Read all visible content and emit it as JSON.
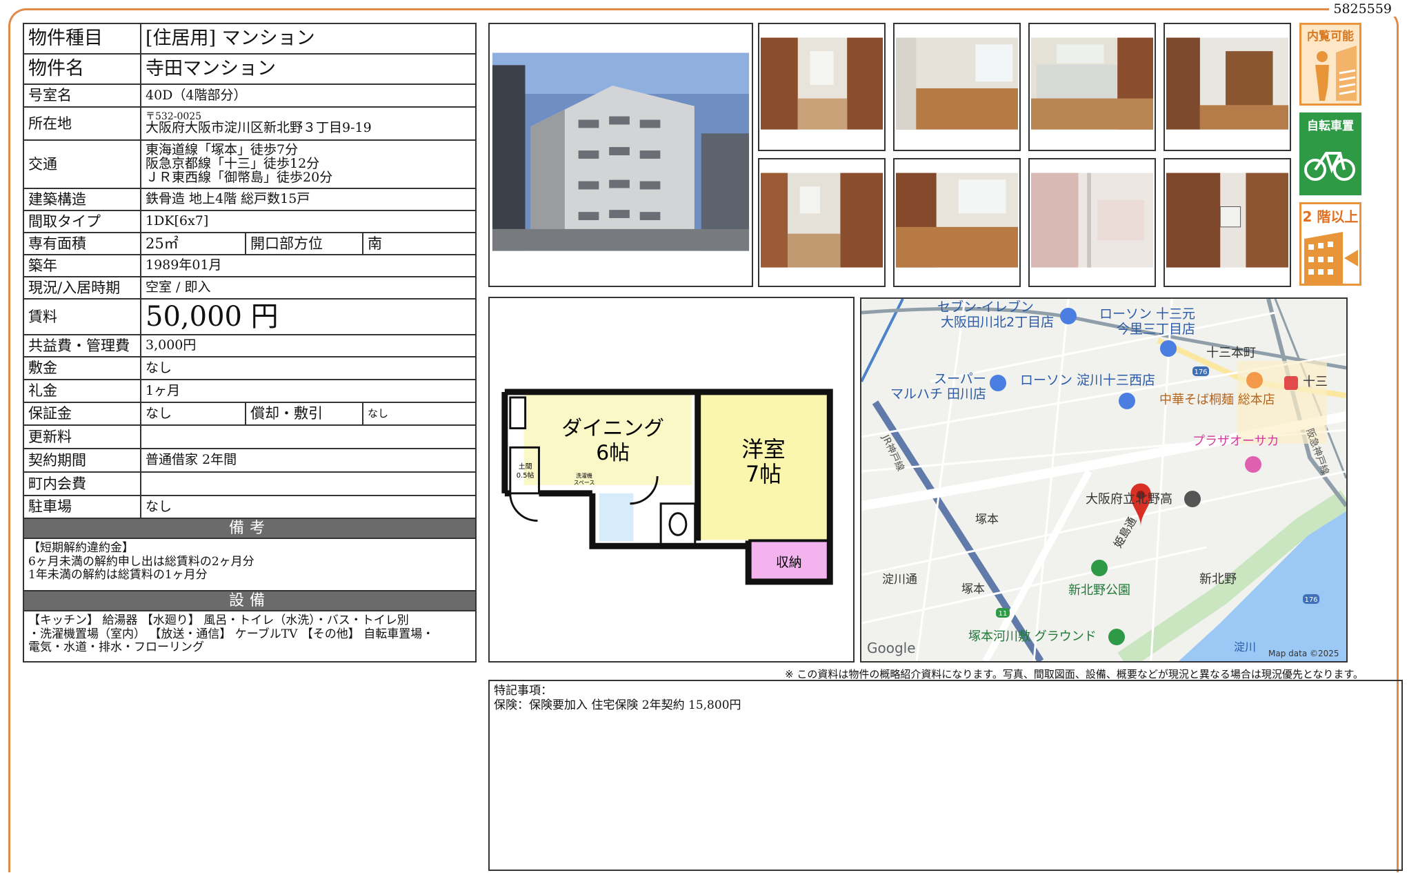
{
  "doc_id": "5825559",
  "rows": {
    "type": {
      "label": "物件種目",
      "value": "[住居用]  マンション"
    },
    "name": {
      "label": "物件名",
      "value": "寺田マンション"
    },
    "room": {
      "label": "号室名",
      "value": "40D（4階部分）"
    },
    "address": {
      "label": "所在地",
      "postal": "〒532-0025",
      "value": "大阪府大阪市淀川区新北野３丁目9-19"
    },
    "access": {
      "label": "交通",
      "lines": [
        "東海道線「塚本」徒歩7分",
        "阪急京都線「十三」徒歩12分",
        "ＪＲ東西線「御幣島」徒歩20分"
      ]
    },
    "structure": {
      "label": "建築構造",
      "value": "鉄骨造 地上4階  総戸数15戸"
    },
    "layout": {
      "label": "間取タイプ",
      "value": "1DK[6x7]"
    },
    "area": {
      "label": "専有面積",
      "value": "25㎡",
      "sub_label": "開口部方位",
      "sub_value": "南"
    },
    "built": {
      "label": "築年",
      "value": "1989年01月"
    },
    "status": {
      "label": "現況/入居時期",
      "value": "空室  /  即入"
    },
    "rent": {
      "label": "賃料",
      "value": "50,000  円"
    },
    "fee": {
      "label": "共益費・管理費",
      "value": "3,000円"
    },
    "deposit": {
      "label": "敷金",
      "value": "なし"
    },
    "key_money": {
      "label": "礼金",
      "value": "1ヶ月"
    },
    "guarantee": {
      "label": "保証金",
      "value": "なし",
      "sub_label": "償却・敷引",
      "sub_value": "なし"
    },
    "renewal": {
      "label": "更新料",
      "value": ""
    },
    "contract": {
      "label": "契約期間",
      "value": "普通借家  2年間"
    },
    "association": {
      "label": "町内会費",
      "value": ""
    },
    "parking": {
      "label": "駐車場",
      "value": "なし"
    }
  },
  "remarks_header": "備考",
  "remarks_lines": [
    "【短期解約違約金】",
    "6ヶ月未満の解約申し出は総賃料の2ヶ月分",
    "1年未満の解約は総賃料の1ヶ月分"
  ],
  "equipment_header": "設備",
  "equipment_lines": [
    "【キッチン】 給湯器  【水廻り】 風呂・トイレ（水洗）・バス・トイレ別",
    "・洗濯機置場（室内） 【放送・通信】 ケーブルTV  【その他】 自転車置場・",
    "電気・水道・排水・フローリング"
  ],
  "badges": [
    {
      "text": "内覧可能",
      "color": "#e8953a"
    },
    {
      "text": "自転車置場",
      "color": "#2e9a45"
    },
    {
      "text": "2 階以上",
      "color": "#e8953a"
    }
  ],
  "floorplan": {
    "dining": "ダイニング",
    "dining_size": "6帖",
    "western": "洋室",
    "western_size": "7帖",
    "storage": "収納",
    "washer_1": "洗濯機",
    "washer_2": "スペース",
    "dirt_1": "土間",
    "dirt_2": "0.5帖"
  },
  "map": {
    "labels": {
      "seven": "セブン-イレブン",
      "seven_sub": "大阪田川北2丁目店",
      "lawson1": "ローソン 十三元",
      "lawson1_sub": "今里三丁目店",
      "juso_town": "十三本町",
      "super": "スーパー",
      "super_sub": "マルハチ 田川店",
      "lawson2": "ローソン 淀川十三西店",
      "soba": "中華そば桐麺 総本店",
      "juso": "十三",
      "plaza": "プラザオーサカ",
      "school": "大阪府立北野高",
      "tsukamoto": "塚本",
      "yodogawa_st": "淀川通",
      "tsukamoto_st": "塚本",
      "park": "新北野公園",
      "shinkitano": "新北野",
      "ground": "塚本河川敷 グラウンド",
      "river": "淀川",
      "himejima": "姫島通",
      "jr_line": "JR神戸線",
      "hankyu_line": "阪急神戸線",
      "road176a": "176",
      "road176b": "176",
      "road11": "11",
      "google": "Google",
      "mapdata": "Map data ©2025"
    },
    "marker_color": "#d93025",
    "water_color": "#9cc8f5"
  },
  "disclaimer": "※  この資料は物件の概略紹介資料になります。写真、間取図面、設備、概要などが現況と異なる場合は現況優先となります。",
  "special_title": "特記事項：",
  "special_text": "保険：保険要加入  住宅保険  2年契約  15,800円"
}
